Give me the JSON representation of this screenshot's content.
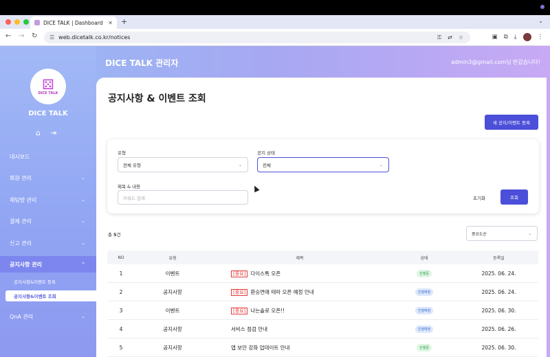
{
  "browser": {
    "tab_title": "DICE TALK | Dashboard",
    "tab_close": "✕",
    "new_tab": "+",
    "url": "web.dicetalk.co.kr/notices",
    "traffic_colors": [
      "#ff5f57",
      "#febc2e",
      "#28c840"
    ]
  },
  "header": {
    "title": "DICE TALK 관리자",
    "greeting": "admin3@gmail.com님 반갑습니다!"
  },
  "sidebar": {
    "logo_text": "DICE TALK",
    "brand": "DICE TALK",
    "menu": [
      {
        "label": "대시보드"
      },
      {
        "label": "회원 관리"
      },
      {
        "label": "채팅방 관리"
      },
      {
        "label": "결제 관리"
      },
      {
        "label": "신고 관리"
      },
      {
        "label": "공지사항 관리"
      },
      {
        "label": "QnA 관리"
      }
    ],
    "sub": [
      {
        "label": "공지사항&이벤트 등록"
      },
      {
        "label": "공지사항&이벤트 조회"
      }
    ]
  },
  "main": {
    "page_title": "공지사항 & 이벤트 조회",
    "new_button": "새 공지/이벤트 등록",
    "filter": {
      "type_label": "유형",
      "type_value": "전체 유형",
      "status_label": "공지 상태",
      "status_value": "전체",
      "keyword_label": "제목 & 내용",
      "keyword_placeholder": "키워드 검색",
      "reset": "초기화",
      "search": "조회"
    },
    "count_prefix": "총 ",
    "count_num": "5",
    "count_suffix": "건",
    "sort_value": "중요도순",
    "columns": [
      "NO",
      "유형",
      "제목",
      "상태",
      "등록일"
    ],
    "rows": [
      {
        "no": "1",
        "type": "이벤트",
        "important": "[중요]",
        "title": "다이스톡 오픈",
        "status": "진행중",
        "date": "2025. 06. 24."
      },
      {
        "no": "2",
        "type": "공지사항",
        "important": "[중요]",
        "title": "환승연애 테마 오픈 예정 안내",
        "status": "진행예정",
        "date": "2025. 06. 24."
      },
      {
        "no": "3",
        "type": "이벤트",
        "important": "[중요]",
        "title": "나는솔로 오픈!!",
        "status": "진행예정",
        "date": "2025. 06. 30."
      },
      {
        "no": "4",
        "type": "공지사항",
        "important": "",
        "title": "서비스 점검 안내",
        "status": "진행예정",
        "date": "2025. 06. 26."
      },
      {
        "no": "5",
        "type": "공지사항",
        "important": "",
        "title": "앱 보안 강화 업데이트 안내",
        "status": "진행중",
        "date": "2025. 06. 30."
      }
    ]
  },
  "colors": {
    "accent": "#4b4fd9",
    "important": "#e23a3a",
    "status_active": "#2f9a4b",
    "status_planned": "#3b6fd1"
  }
}
